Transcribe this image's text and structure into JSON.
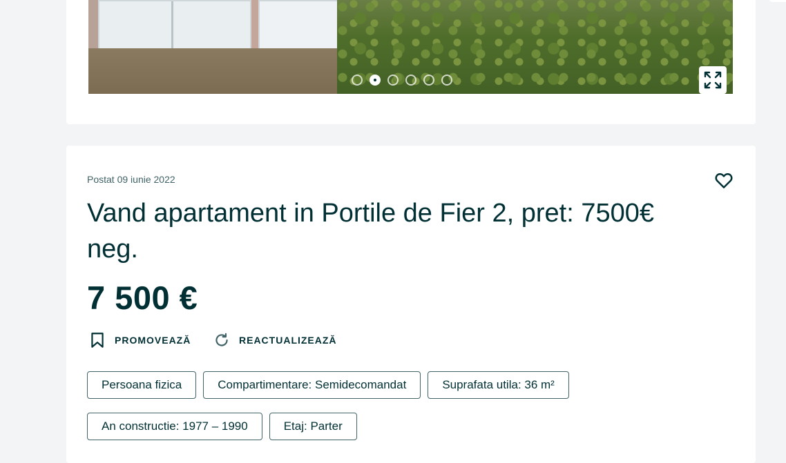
{
  "gallery": {
    "photo_description_icon": "listing-photo",
    "dots_total": 6,
    "active_index": 1,
    "expand_icon": "expand-icon"
  },
  "listing": {
    "posted": "Postat 09 iunie 2022",
    "title": "Vand apartament in Portile de Fier 2, pret: 7500€ neg.",
    "price": "7 500 €",
    "favorite_icon": "heart-icon"
  },
  "actions": {
    "promote_label": "PROMOVEAZĂ",
    "promote_icon": "bookmark-icon",
    "refresh_label": "REACTUALIZEAZĂ",
    "refresh_icon": "refresh-icon"
  },
  "params": [
    "Persoana fizica",
    "Compartimentare: Semidecomandat",
    "Suprafata utila: 36 m²",
    "An constructie: 1977 – 1990",
    "Etaj: Parter"
  ],
  "colors": {
    "text": "#002f34",
    "muted": "#406367",
    "background": "#f2f4f5",
    "card": "#ffffff"
  }
}
